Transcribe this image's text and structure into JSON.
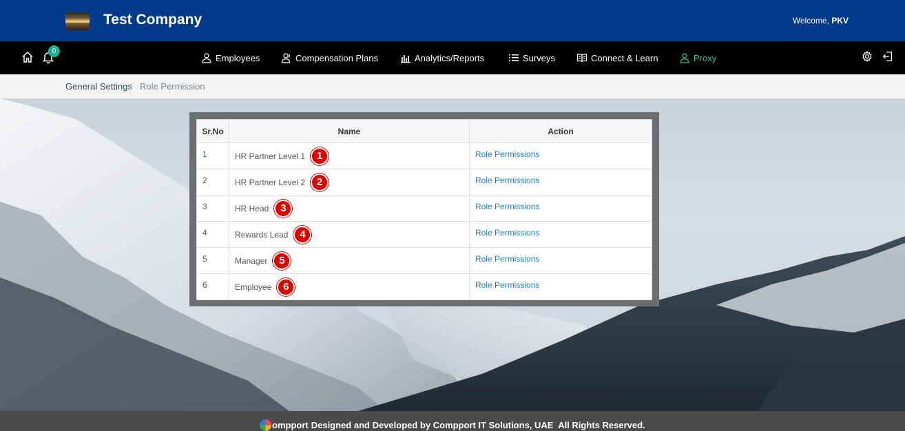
{
  "header": {
    "company_name": "Test Company",
    "welcome_prefix": "Welcome,",
    "user_name": "PKV"
  },
  "nav": {
    "notification_count": "0",
    "items": [
      {
        "label": "Employees",
        "icon": "user-icon"
      },
      {
        "label": "Compensation Plans",
        "icon": "users-icon"
      },
      {
        "label": "Analytics/Reports",
        "icon": "bar-chart-icon"
      },
      {
        "label": "Surveys",
        "icon": "list-icon"
      },
      {
        "label": "Connect & Learn",
        "icon": "book-icon"
      },
      {
        "label": "Proxy",
        "icon": "user-icon",
        "active": true
      }
    ],
    "active_color": "#2fc59e"
  },
  "breadcrumb": {
    "parent": "General Settings",
    "separator": "/",
    "current": "Role Permission"
  },
  "table": {
    "headers": [
      "Sr.No",
      "Name",
      "Action"
    ],
    "rows": [
      {
        "sr": "1",
        "name": "HR Partner Level 1",
        "marker": "1",
        "action": "Role Permissions"
      },
      {
        "sr": "2",
        "name": "HR Partner Level 2",
        "marker": "2",
        "action": "Role Permissions"
      },
      {
        "sr": "3",
        "name": "HR Head",
        "marker": "3",
        "action": "Role Permissions"
      },
      {
        "sr": "4",
        "name": "Rewards Lead",
        "marker": "4",
        "action": "Role Permissions"
      },
      {
        "sr": "5",
        "name": "Manager",
        "marker": "5",
        "action": "Role Permissions"
      },
      {
        "sr": "6",
        "name": "Employee",
        "marker": "6",
        "action": "Role Permissions"
      }
    ]
  },
  "footer": {
    "logo_text": "ompport",
    "text": "Designed and Developed by Compport IT Solutions, UAE  All Rights Reserved."
  },
  "colors": {
    "header_bg": "#003a88",
    "nav_bg": "#000000",
    "link": "#1c7fc4",
    "marker": "#e00000",
    "footer_bg": "#4a4a4a"
  }
}
